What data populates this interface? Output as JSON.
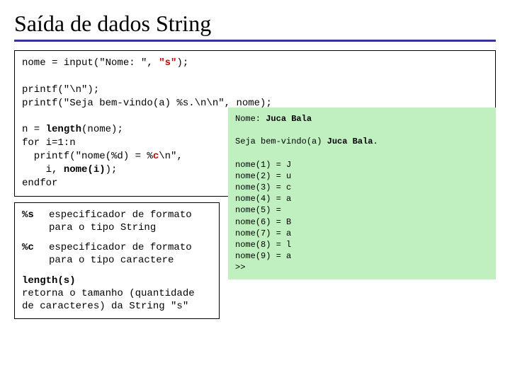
{
  "title": "Saída de dados String",
  "code": {
    "l1a": "nome = input(\"Nome: \", ",
    "l1b": "\"s\"",
    "l1c": ");",
    "l2": "",
    "l3": "printf(\"\\n\");",
    "l4": "printf(\"Seja bem-vindo(a) %s.\\n\\n\", nome);",
    "l5": "",
    "l6a": "n = ",
    "l6b": "length",
    "l6c": "(nome);",
    "l7": "for i=1:n",
    "l8a": "  printf(\"nome(%d) = %",
    "l8b": "c",
    "l8c": "\\n\",",
    "l9a": "    i, ",
    "l9b": "nome(i)",
    "l9c": ");",
    "l10": "endfor"
  },
  "info": {
    "k1": "%s",
    "v1": "especificador de formato para o tipo String",
    "k2": "%c",
    "v2": "especificador de formato para o tipo caractere",
    "k3": "length(s)",
    "v3": "retorna o tamanho (quantidade de caracteres) da String \"s\""
  },
  "output": {
    "prompt": "Nome: ",
    "name": "Juca Bala",
    "welcome_a": "Seja bem-vindo(a) ",
    "welcome_b": "Juca Bala",
    "welcome_c": ".",
    "rows": [
      "nome(1) = J",
      "nome(2) = u",
      "nome(3) = c",
      "nome(4) = a",
      "nome(5) = ",
      "nome(6) = B",
      "nome(7) = a",
      "nome(8) = l",
      "nome(9) = a"
    ],
    "cursor": ">>"
  }
}
